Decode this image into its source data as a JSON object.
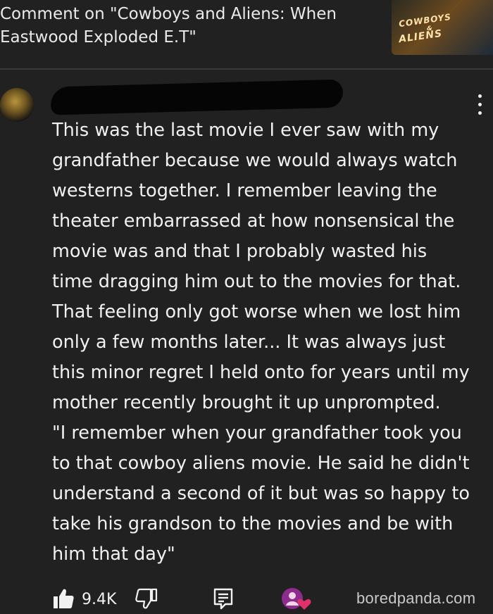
{
  "header": {
    "title": "Comment on \"Cowboys and Aliens: When\nEastwood Exploded E.T\"",
    "thumbnail": {
      "line1": "COWBOYS",
      "amp": "&",
      "line2": "ALIENS"
    }
  },
  "comment": {
    "author": "",
    "text": "This was the last movie I ever saw with my\ngrandfather because we would always watch\nwesterns together. I remember leaving the\ntheater embarrassed at how nonsensical the\nmovie was and that I probably wasted his\ntime dragging him out to the movies for that.\nThat feeling only got worse when we lost him\nonly a few months later... It was always just\nthis minor regret I held onto for years until my\nmother recently brought it up unprompted.\n\"I remember when your grandfather took you\nto that cowboy aliens movie. He said he didn't\nunderstand a second of it but was so happy to\ntake his grandson to the movies and be with\nhim that day\""
  },
  "actions": {
    "like_count": "9.4K"
  },
  "watermark": "boredpanda.com",
  "colors": {
    "background": "#212121",
    "text": "#f1f1f1",
    "heart_badge": "#e1306c"
  }
}
